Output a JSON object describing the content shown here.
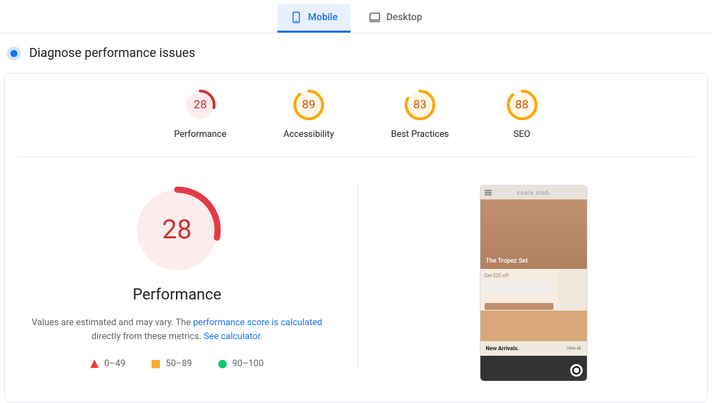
{
  "tabs": {
    "mobile": "Mobile",
    "desktop": "Desktop"
  },
  "section_title": "Diagnose performance issues",
  "gauges": {
    "performance": {
      "score": "28",
      "label": "Performance"
    },
    "accessibility": {
      "score": "89",
      "label": "Accessibility"
    },
    "best_practices": {
      "score": "83",
      "label": "Best Practices"
    },
    "seo": {
      "score": "88",
      "label": "SEO"
    }
  },
  "detail": {
    "score": "28",
    "label": "Performance",
    "desc_prefix": "Values are estimated and may vary. The ",
    "desc_link1": "performance score is calculated",
    "desc_mid": " directly from these metrics. ",
    "desc_link2": "See calculator.",
    "legend": {
      "bad": "0–49",
      "mid": "50–89",
      "good": "90–100"
    }
  },
  "preview": {
    "brand": "cools club",
    "hero": "The Tropez Set",
    "promo": "Get $25 off",
    "section": "New Arrivals.",
    "viewall": "View all"
  },
  "colors": {
    "bad": "#cc3333",
    "mid": "#fa3",
    "good": "#0c6"
  }
}
